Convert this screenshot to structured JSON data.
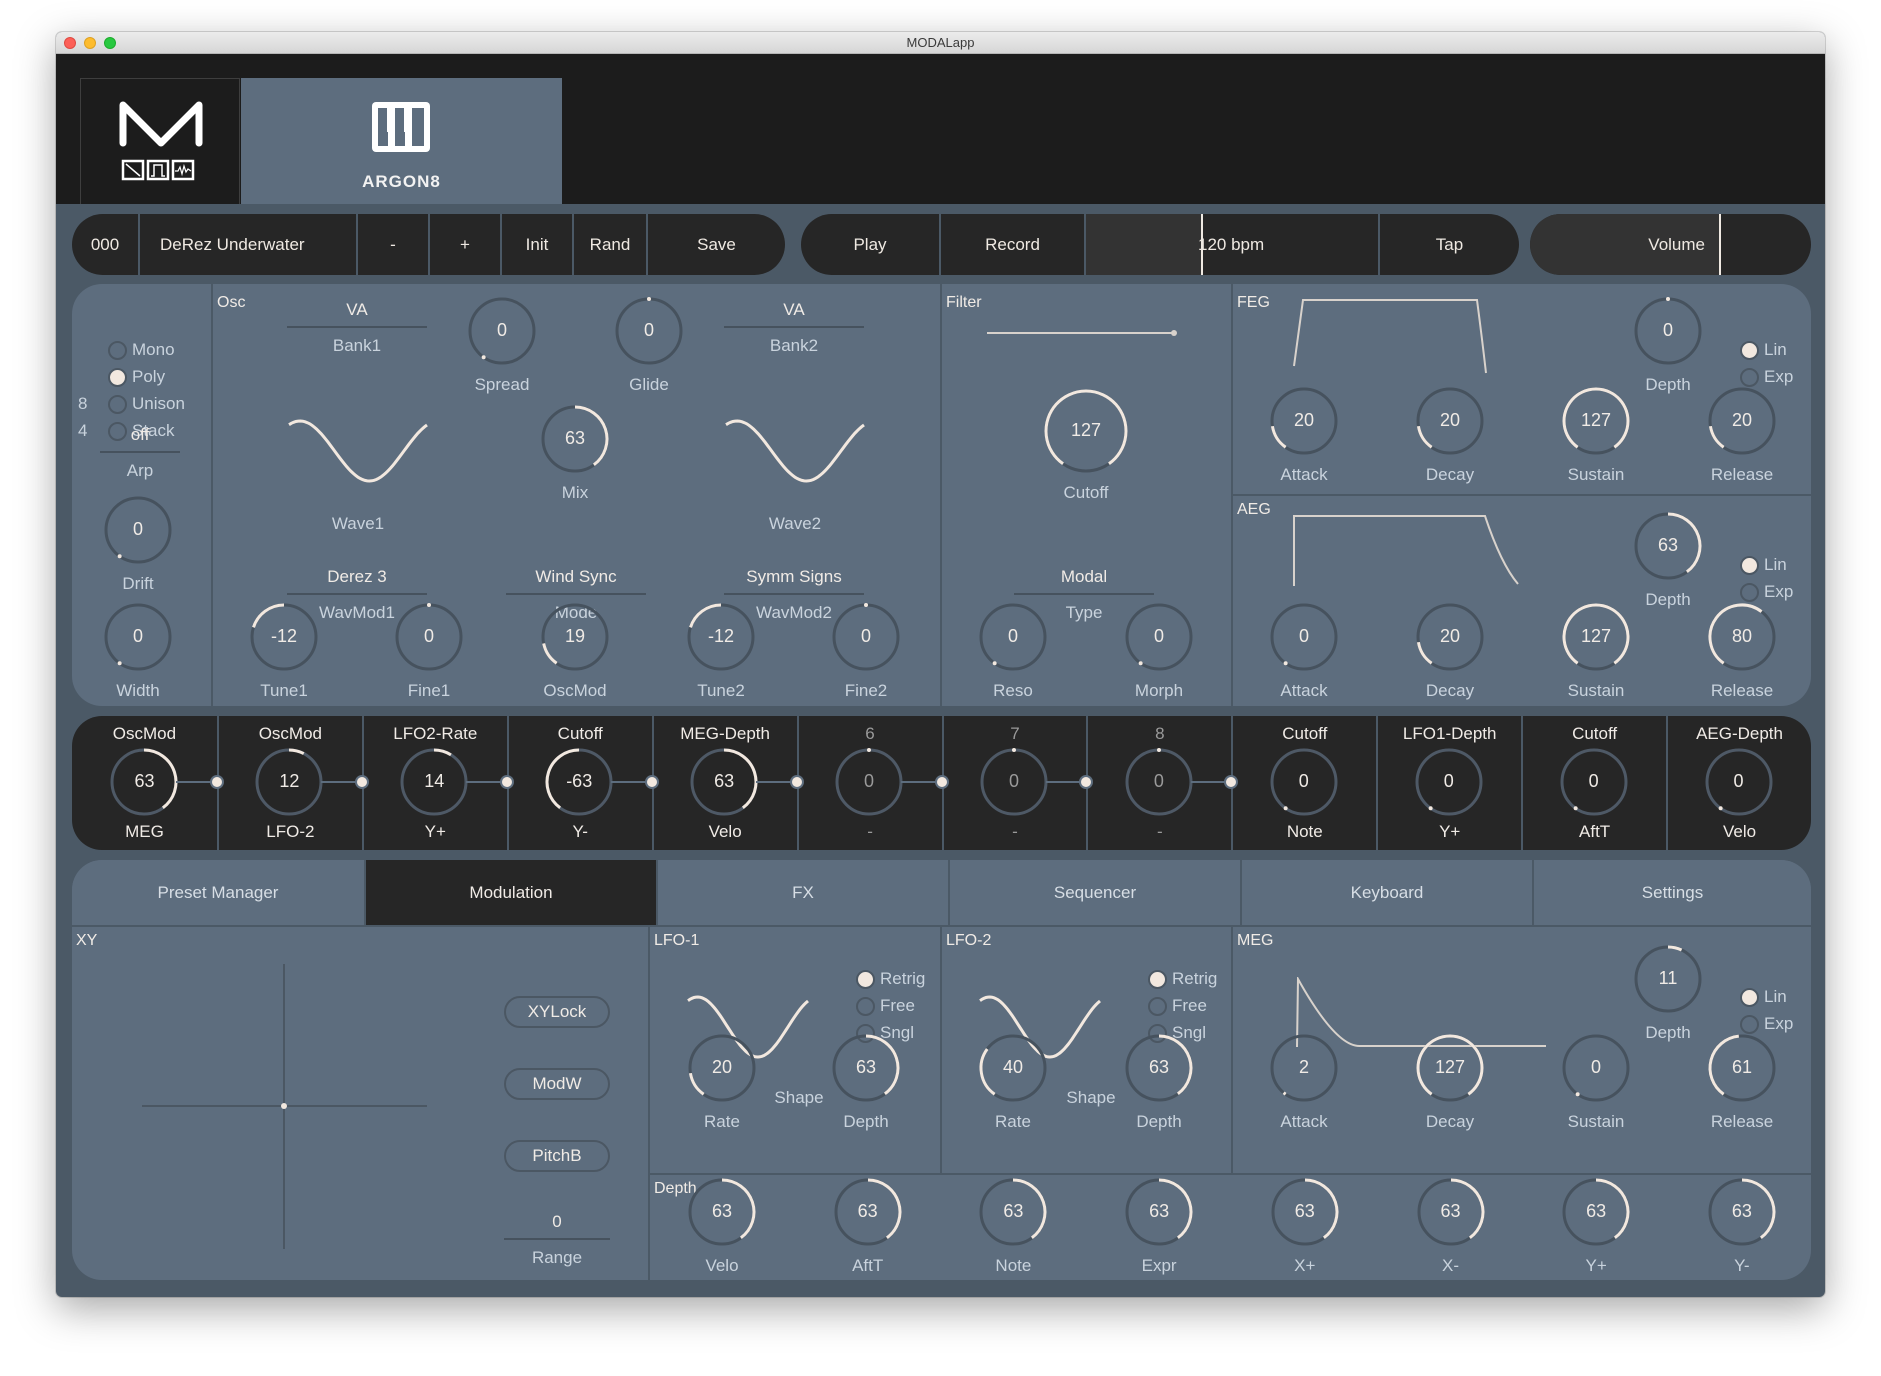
{
  "window": {
    "title": "MODALapp"
  },
  "header": {
    "synth_name": "ARGON8",
    "logo": "modal-logo-icon",
    "synth_icon": "piano-keys-icon"
  },
  "toolbar": {
    "preset_number": "000",
    "preset_name": "DeRez Underwater",
    "minus_label": "-",
    "plus_label": "+",
    "init_label": "Init",
    "rand_label": "Rand",
    "save_label": "Save",
    "play_label": "Play",
    "record_label": "Record",
    "tempo": "120 bpm",
    "tempo_fill": 0.4,
    "tap_label": "Tap",
    "volume_label": "Volume",
    "volume_fill": 0.68
  },
  "voice": {
    "modes": [
      {
        "label": "Mono",
        "count": "",
        "selected": false
      },
      {
        "label": "Poly",
        "count": "",
        "selected": true
      },
      {
        "label": "Unison",
        "count": "8",
        "selected": false
      },
      {
        "label": "Stack",
        "count": "4",
        "selected": false
      }
    ],
    "arp": {
      "value": "off",
      "label": "Arp"
    },
    "drift": {
      "value": 0,
      "label": "Drift"
    },
    "width": {
      "value": 0,
      "label": "Width"
    }
  },
  "osc": {
    "title": "Osc",
    "bank1": {
      "value": "VA",
      "label": "Bank1"
    },
    "bank2": {
      "value": "VA",
      "label": "Bank2"
    },
    "wave1_label": "Wave1",
    "wave2_label": "Wave2",
    "spread": {
      "value": 0,
      "label": "Spread"
    },
    "glide": {
      "value": 0,
      "label": "Glide"
    },
    "mix": {
      "value": 63,
      "label": "Mix"
    },
    "wavmod1": {
      "value": "Derez 3",
      "label": "WavMod1"
    },
    "mode": {
      "value": "Wind Sync",
      "label": "Mode"
    },
    "wavmod2": {
      "value": "Symm Signs",
      "label": "WavMod2"
    },
    "tune1": {
      "value": -12,
      "label": "Tune1"
    },
    "fine1": {
      "value": 0,
      "label": "Fine1"
    },
    "oscmod": {
      "value": 19,
      "label": "OscMod"
    },
    "tune2": {
      "value": -12,
      "label": "Tune2"
    },
    "fine2": {
      "value": 0,
      "label": "Fine2"
    }
  },
  "filter": {
    "title": "Filter",
    "cutoff": {
      "value": 127,
      "label": "Cutoff"
    },
    "type": {
      "value": "Modal",
      "label": "Type"
    },
    "reso": {
      "value": 0,
      "label": "Reso"
    },
    "morph": {
      "value": 0,
      "label": "Morph"
    }
  },
  "feg": {
    "title": "FEG",
    "depth": {
      "value": 0,
      "label": "Depth"
    },
    "curve": [
      {
        "label": "Lin",
        "selected": true
      },
      {
        "label": "Exp",
        "selected": false
      }
    ],
    "attack": {
      "value": 20,
      "label": "Attack"
    },
    "decay": {
      "value": 20,
      "label": "Decay"
    },
    "sustain": {
      "value": 127,
      "label": "Sustain"
    },
    "release": {
      "value": 20,
      "label": "Release"
    }
  },
  "aeg": {
    "title": "AEG",
    "depth": {
      "value": 63,
      "label": "Depth"
    },
    "curve": [
      {
        "label": "Lin",
        "selected": true
      },
      {
        "label": "Exp",
        "selected": false
      }
    ],
    "attack": {
      "value": 0,
      "label": "Attack"
    },
    "decay": {
      "value": 20,
      "label": "Decay"
    },
    "sustain": {
      "value": 127,
      "label": "Sustain"
    },
    "release": {
      "value": 80,
      "label": "Release"
    }
  },
  "mod_matrix": [
    {
      "target": "OscMod",
      "amount": 63,
      "source": "MEG",
      "dim": false
    },
    {
      "target": "OscMod",
      "amount": 12,
      "source": "LFO-2",
      "dim": false
    },
    {
      "target": "LFO2-Rate",
      "amount": 14,
      "source": "Y+",
      "dim": false
    },
    {
      "target": "Cutoff",
      "amount": -63,
      "source": "Y-",
      "dim": false
    },
    {
      "target": "MEG-Depth",
      "amount": 63,
      "source": "Velo",
      "dim": false
    },
    {
      "target": "6",
      "amount": 0,
      "source": "-",
      "dim": true
    },
    {
      "target": "7",
      "amount": 0,
      "source": "-",
      "dim": true
    },
    {
      "target": "8",
      "amount": 0,
      "source": "-",
      "dim": true
    },
    {
      "target": "Cutoff",
      "amount": 0,
      "source": "Note",
      "dim": false
    },
    {
      "target": "LFO1-Depth",
      "amount": 0,
      "source": "Y+",
      "dim": false
    },
    {
      "target": "Cutoff",
      "amount": 0,
      "source": "AftT",
      "dim": false
    },
    {
      "target": "AEG-Depth",
      "amount": 0,
      "source": "Velo",
      "dim": false
    }
  ],
  "tabs": [
    {
      "label": "Preset Manager",
      "active": false
    },
    {
      "label": "Modulation",
      "active": true
    },
    {
      "label": "FX",
      "active": false
    },
    {
      "label": "Sequencer",
      "active": false
    },
    {
      "label": "Keyboard",
      "active": false
    },
    {
      "label": "Settings",
      "active": false
    }
  ],
  "xy": {
    "title": "XY",
    "xylock_label": "XYLock",
    "modw_label": "ModW",
    "pitchb_label": "PitchB",
    "range": {
      "value": "0",
      "label": "Range"
    }
  },
  "lfo1": {
    "title": "LFO-1",
    "modes": [
      {
        "label": "Retrig",
        "selected": true
      },
      {
        "label": "Free",
        "selected": false
      },
      {
        "label": "Sngl",
        "selected": false
      }
    ],
    "rate": {
      "value": 20,
      "label": "Rate"
    },
    "shape_label": "Shape",
    "depth": {
      "value": 63,
      "label": "Depth"
    }
  },
  "lfo2": {
    "title": "LFO-2",
    "modes": [
      {
        "label": "Retrig",
        "selected": true
      },
      {
        "label": "Free",
        "selected": false
      },
      {
        "label": "Sngl",
        "selected": false
      }
    ],
    "rate": {
      "value": 40,
      "label": "Rate"
    },
    "shape_label": "Shape",
    "depth": {
      "value": 63,
      "label": "Depth"
    }
  },
  "meg": {
    "title": "MEG",
    "depth": {
      "value": 11,
      "label": "Depth"
    },
    "curve": [
      {
        "label": "Lin",
        "selected": true
      },
      {
        "label": "Exp",
        "selected": false
      }
    ],
    "attack": {
      "value": 2,
      "label": "Attack"
    },
    "decay": {
      "value": 127,
      "label": "Decay"
    },
    "sustain": {
      "value": 0,
      "label": "Sustain"
    },
    "release": {
      "value": 61,
      "label": "Release"
    }
  },
  "depth_section": {
    "title": "Depth",
    "knobs": [
      {
        "value": 63,
        "label": "Velo"
      },
      {
        "value": 63,
        "label": "AftT"
      },
      {
        "value": 63,
        "label": "Note"
      },
      {
        "value": 63,
        "label": "Expr"
      },
      {
        "value": 63,
        "label": "X+"
      },
      {
        "value": 63,
        "label": "X-"
      },
      {
        "value": 63,
        "label": "Y+"
      },
      {
        "value": 63,
        "label": "Y-"
      }
    ]
  },
  "colors": {
    "panel": "#5d6d7e",
    "background": "#4b5966",
    "dark": "#262626",
    "accent": "#f2e8df",
    "knob_track": "#46525e"
  }
}
